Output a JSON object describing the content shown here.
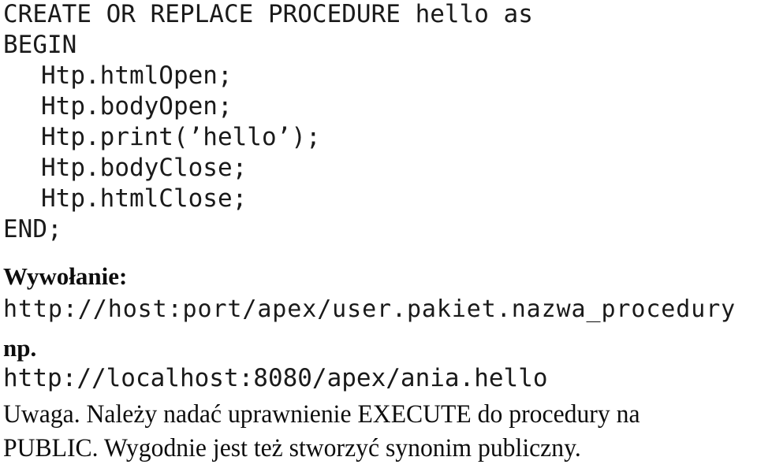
{
  "document": {
    "language": "pl",
    "background_color": "#ffffff",
    "text_color": "#141414",
    "code_block": {
      "lines": [
        {
          "text": "CREATE OR REPLACE PROCEDURE hello as",
          "indent": false
        },
        {
          "text": "BEGIN",
          "indent": false
        },
        {
          "text": "Htp.htmlOpen;",
          "indent": true
        },
        {
          "text": "Htp.bodyOpen;",
          "indent": true
        },
        {
          "text": "Htp.print(’hello’);",
          "indent": true
        },
        {
          "text": "Htp.bodyClose;",
          "indent": true
        },
        {
          "text": "Htp.htmlClose;",
          "indent": true
        },
        {
          "text": "END;",
          "indent": false
        }
      ]
    },
    "call_section": {
      "heading": "Wywołanie:",
      "url_template": "http://host:port/apex/user.pakiet.nazwa_procedury",
      "example_label": "np.",
      "example_url": "http://localhost:8080/apex/ania.hello"
    },
    "note": {
      "line1": "Uwaga. Należy nadać uprawnienie EXECUTE do procedury na",
      "line2": "PUBLIC. Wygodnie jest też stworzyć synonim publiczny."
    }
  }
}
